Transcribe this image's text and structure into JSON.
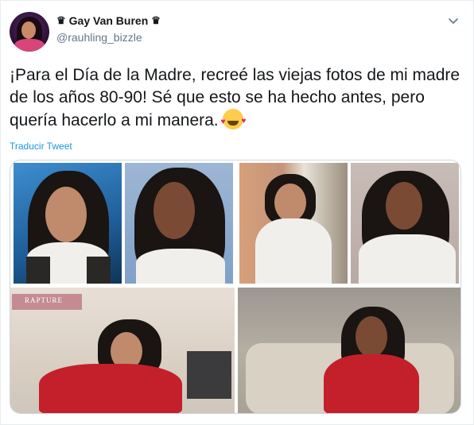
{
  "tweet": {
    "author_name": "Gay Van Buren",
    "author_handle": "@rauhling_bizzle",
    "name_prefix_icon": "♛",
    "name_suffix_icon": "♛",
    "body": "¡Para el Día de la Madre, recreé las viejas fotos de mi madre de los años 80-90! Sé que esto se ha hecho antes, pero quería hacerlo a mi manera.",
    "emoji": "smiling-face-with-hearts-icon",
    "translate_link": "Traducir Tweet",
    "poster_text": "RAPTURE"
  },
  "colors": {
    "link": "#1b95e0",
    "secondary_text": "#657786",
    "primary_text": "#14171a",
    "border": "#e6ecf0"
  }
}
